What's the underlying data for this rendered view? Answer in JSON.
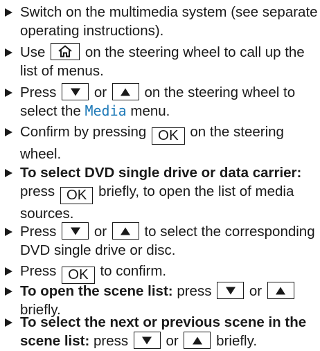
{
  "accent_color": "#1f7ab8",
  "steps": [
    {
      "text": "Switch on the multimedia system (see separate operating instructions)."
    },
    {
      "a": "Use",
      "b": "on the steering wheel to call up the list of menus."
    },
    {
      "a": "Press",
      "or": "or",
      "b": "on the steering wheel to select the",
      "menu": "Media",
      "c": "menu."
    },
    {
      "a": "Confirm by pressing",
      "key": "OK",
      "b": "on the steering wheel."
    },
    {
      "bold": "To select DVD single drive or data carrier:",
      "a": "press",
      "key": "OK",
      "b": "briefly, to open the list of media sources."
    },
    {
      "a": "Press",
      "or": "or",
      "b": "to select the corresponding DVD single drive or disc."
    },
    {
      "a": "Press",
      "key": "OK",
      "b": "to confirm."
    },
    {
      "bold": "To open the scene list:",
      "a": "press",
      "or": "or",
      "b": "briefly."
    },
    {
      "bold": "To select the next or previous scene in the scene list:",
      "a": "press",
      "or": "or",
      "b": "briefly."
    }
  ]
}
